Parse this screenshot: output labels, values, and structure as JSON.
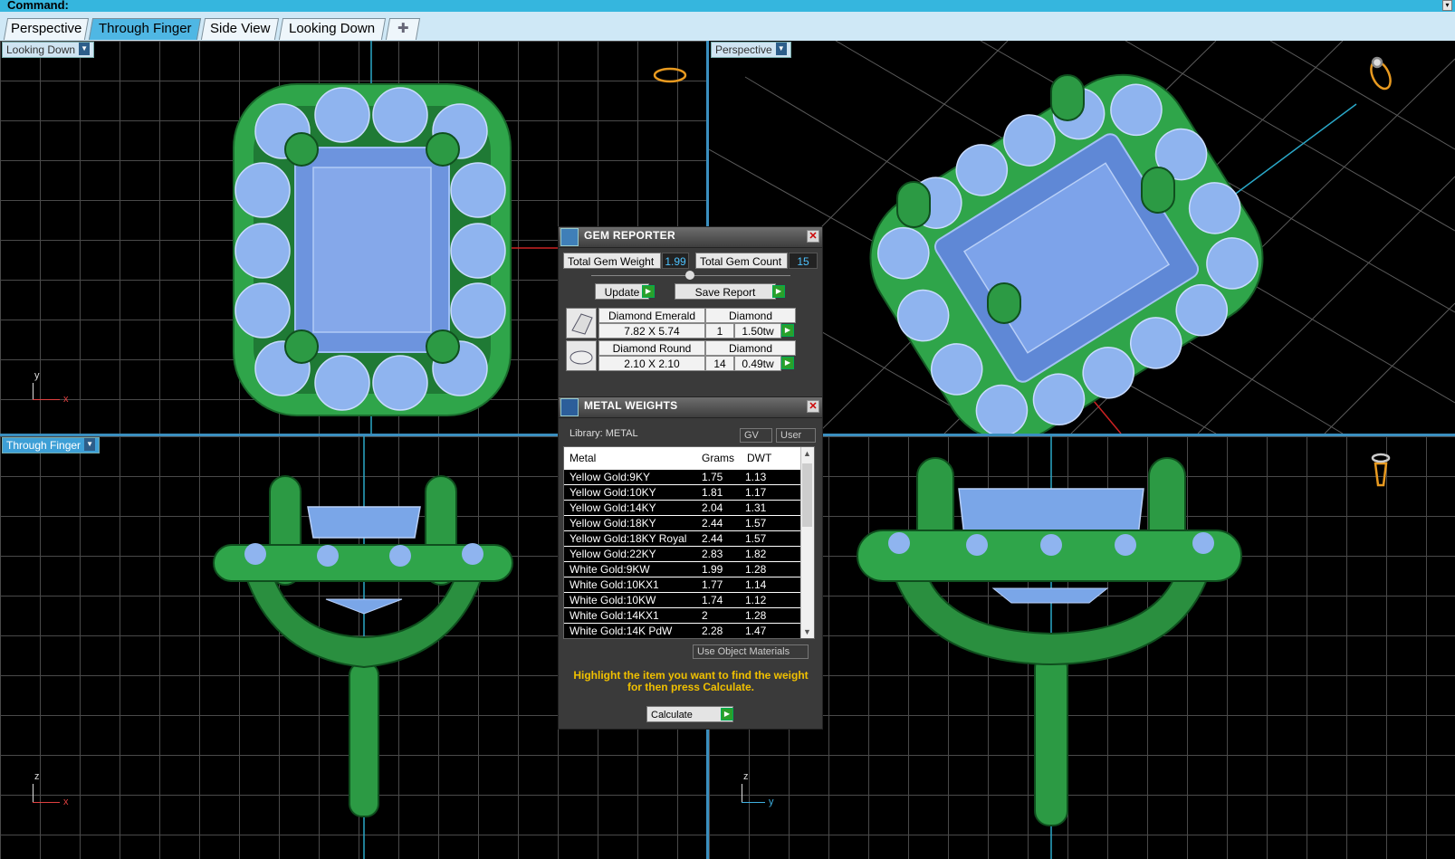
{
  "command_bar": {
    "label": "Command:"
  },
  "tabs": [
    {
      "label": "Perspective",
      "active": false
    },
    {
      "label": "Through Finger",
      "active": true
    },
    {
      "label": "Side View",
      "active": false
    },
    {
      "label": "Looking Down",
      "active": false
    }
  ],
  "add_tab_glyph": "✚",
  "viewports": {
    "top_left": {
      "label": "Looking Down",
      "axis_v": "y",
      "axis_h": "x"
    },
    "top_right": {
      "label": "Perspective"
    },
    "bottom_left": {
      "label": "Through Finger",
      "axis_v": "z",
      "axis_h": "x"
    },
    "bottom_right": {
      "axis_v": "z",
      "axis_h": "y"
    }
  },
  "gem_reporter": {
    "title": "GEM REPORTER",
    "total_weight_label": "Total Gem Weight",
    "total_weight_value": "1.99",
    "total_count_label": "Total Gem Count",
    "total_count_value": "15",
    "update_label": "Update",
    "save_report_label": "Save Report",
    "gems": [
      {
        "name": "Diamond Emerald",
        "type": "Diamond",
        "size": "7.82 X 5.74",
        "count": "1",
        "weight": "1.50tw"
      },
      {
        "name": "Diamond Round",
        "type": "Diamond",
        "size": "2.10 X 2.10",
        "count": "14",
        "weight": "0.49tw"
      }
    ]
  },
  "metal_weights": {
    "title": "METAL WEIGHTS",
    "library_label": "Library: METAL",
    "gv_label": "GV",
    "user_label": "User",
    "columns": [
      "Metal",
      "Grams",
      "DWT"
    ],
    "rows": [
      [
        "Yellow Gold:9KY",
        "1.75",
        "1.13"
      ],
      [
        "Yellow Gold:10KY",
        "1.81",
        "1.17"
      ],
      [
        "Yellow Gold:14KY",
        "2.04",
        "1.31"
      ],
      [
        "Yellow Gold:18KY",
        "2.44",
        "1.57"
      ],
      [
        "Yellow Gold:18KY Royal",
        "2.44",
        "1.57"
      ],
      [
        "Yellow Gold:22KY",
        "2.83",
        "1.82"
      ],
      [
        "White Gold:9KW",
        "1.99",
        "1.28"
      ],
      [
        "White Gold:10KX1",
        "1.77",
        "1.14"
      ],
      [
        "White Gold:10KW",
        "1.74",
        "1.12"
      ],
      [
        "White Gold:14KX1",
        "2",
        "1.28"
      ],
      [
        "White Gold:14K PdW",
        "2.28",
        "1.47"
      ]
    ],
    "use_object_materials_label": "Use Object Materials",
    "hint_text": "Highlight the item you want to find the weight for then press Calculate.",
    "calculate_label": "Calculate"
  },
  "colors": {
    "command_bar": "#35b6de",
    "active_tab": "#4fb7e4",
    "metal_green": "#2fa54a",
    "gem_blue": "#7aa6e8",
    "hint_yellow": "#f0c000"
  }
}
